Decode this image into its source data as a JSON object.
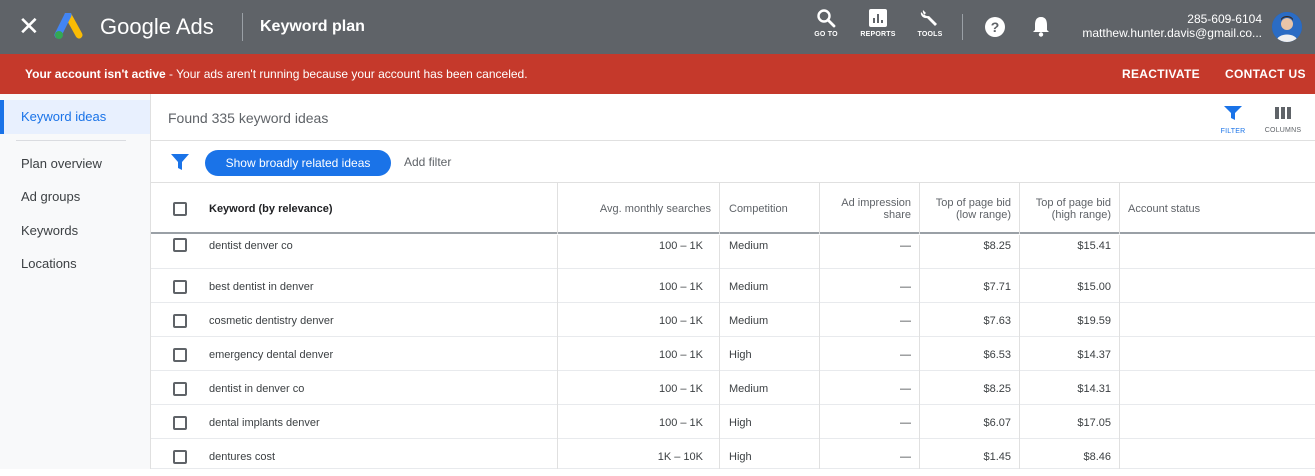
{
  "header": {
    "brand": "Google Ads",
    "page_title": "Keyword plan",
    "tools": [
      {
        "label": "GO TO",
        "icon": "search-icon"
      },
      {
        "label": "REPORTS",
        "icon": "reports-icon"
      },
      {
        "label": "TOOLS",
        "icon": "wrench-icon"
      }
    ],
    "account_phone": "285-609-6104",
    "account_email": "matthew.hunter.davis@gmail.co..."
  },
  "banner": {
    "title": "Your account isn't active",
    "message": " - Your ads aren't running because your account has been canceled.",
    "reactivate": "REACTIVATE",
    "contact": "CONTACT US",
    "color": "#c5392b"
  },
  "sidebar": {
    "items": [
      {
        "label": "Keyword ideas",
        "active": true
      },
      {
        "label": "Plan overview"
      },
      {
        "label": "Ad groups"
      },
      {
        "label": "Keywords"
      },
      {
        "label": "Locations"
      }
    ]
  },
  "main": {
    "found_text": "Found 335 keyword ideas",
    "filter_label": "FILTER",
    "columns_label": "COLUMNS",
    "chip_label": "Show broadly related ideas",
    "add_filter": "Add filter",
    "accent": "#1a73e8"
  },
  "table": {
    "headers": {
      "keyword": "Keyword (by relevance)",
      "searches": "Avg. monthly searches",
      "competition": "Competition",
      "impression": "Ad impression share",
      "bid_low": "Top of page bid (low range)",
      "bid_high": "Top of page bid (high range)",
      "status": "Account status"
    },
    "rows": [
      {
        "keyword": "dentist denver co",
        "searches": "100 – 1K",
        "competition": "Medium",
        "impression": "—",
        "bid_low": "$8.25",
        "bid_high": "$15.41",
        "status": ""
      },
      {
        "keyword": "best dentist in denver",
        "searches": "100 – 1K",
        "competition": "Medium",
        "impression": "—",
        "bid_low": "$7.71",
        "bid_high": "$15.00",
        "status": ""
      },
      {
        "keyword": "cosmetic dentistry denver",
        "searches": "100 – 1K",
        "competition": "Medium",
        "impression": "—",
        "bid_low": "$7.63",
        "bid_high": "$19.59",
        "status": ""
      },
      {
        "keyword": "emergency dental denver",
        "searches": "100 – 1K",
        "competition": "High",
        "impression": "—",
        "bid_low": "$6.53",
        "bid_high": "$14.37",
        "status": ""
      },
      {
        "keyword": "dentist in denver co",
        "searches": "100 – 1K",
        "competition": "Medium",
        "impression": "—",
        "bid_low": "$8.25",
        "bid_high": "$14.31",
        "status": ""
      },
      {
        "keyword": "dental implants denver",
        "searches": "100 – 1K",
        "competition": "High",
        "impression": "—",
        "bid_low": "$6.07",
        "bid_high": "$17.05",
        "status": ""
      },
      {
        "keyword": "dentures cost",
        "searches": "1K – 10K",
        "competition": "High",
        "impression": "—",
        "bid_low": "$1.45",
        "bid_high": "$8.46",
        "status": ""
      }
    ]
  }
}
